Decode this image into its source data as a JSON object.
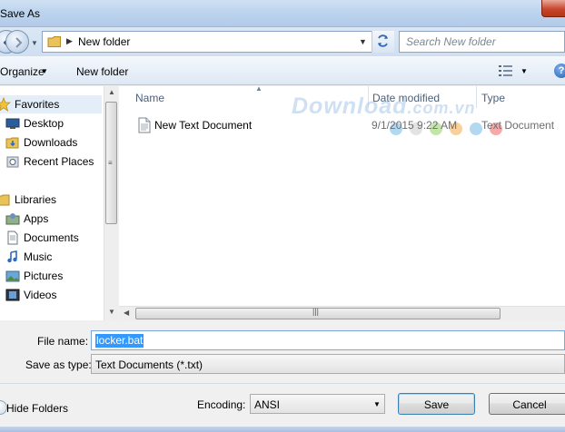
{
  "window": {
    "title": "Save As"
  },
  "address": {
    "path_current": "New folder",
    "search_placeholder": "Search New folder"
  },
  "toolbar": {
    "organize_label": "Organize",
    "new_folder_label": "New folder"
  },
  "nav": {
    "favorites_header": "Favorites",
    "favorites": [
      "Desktop",
      "Downloads",
      "Recent Places"
    ],
    "libraries_header": "Libraries",
    "libraries": [
      "Apps",
      "Documents",
      "Music",
      "Pictures",
      "Videos"
    ]
  },
  "columns": {
    "name": "Name",
    "date_modified": "Date modified",
    "type": "Type"
  },
  "files": [
    {
      "name": "New Text Document",
      "date_modified": "9/1/2015 9:22 AM",
      "type": "Text Document"
    }
  ],
  "watermark": {
    "main": "Download",
    "suffix": ".com.vn"
  },
  "form": {
    "file_name_label": "File name:",
    "file_name_value": "locker.bat",
    "save_as_type_label": "Save as type:",
    "save_as_type_value": "Text Documents (*.txt)",
    "hide_folders_label": "Hide Folders",
    "encoding_label": "Encoding:",
    "encoding_value": "ANSI",
    "save_label": "Save",
    "cancel_label": "Cancel"
  },
  "colors": {
    "selection": "#3399ff",
    "titlebar": "#bcd3ed",
    "close": "#c8462d"
  }
}
